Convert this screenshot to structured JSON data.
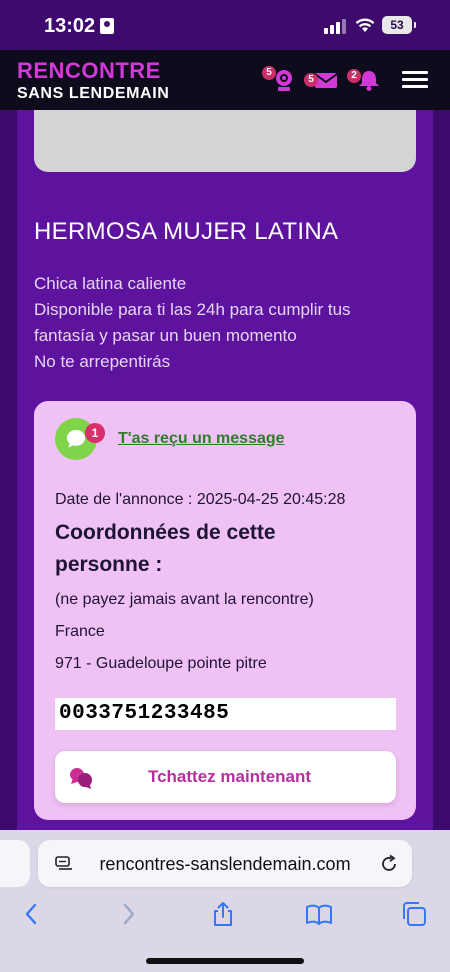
{
  "status_bar": {
    "time": "13:02",
    "battery": "53"
  },
  "header": {
    "logo_line1": "RENCONTRE",
    "logo_line2": "SANS LENDEMAIN",
    "webcam_badge": "5",
    "mail_badge": "5",
    "bell_badge": "2",
    "accent_color": "#d13ad7"
  },
  "ad": {
    "title": "HERMOSA MUJER LATINA",
    "description": [
      "Chica latina caliente",
      "Disponible para ti las 24h para cumplir tus",
      "fantasía y pasar un buen momento",
      "No te arrepentirás"
    ]
  },
  "info_box": {
    "message_badge": "1",
    "message_link": "T'as reçu un message",
    "date_line": "Date de l'annonce : 2025-04-25 20:45:28",
    "coords_heading": "Coordonnées de cette personne :",
    "warning": "(ne payez jamais avant la rencontre)",
    "country": "France",
    "region": "971 - Guadeloupe pointe pitre",
    "phone": "0033751233485",
    "chat_button": "Tchattez maintenant"
  },
  "browser": {
    "url": "rencontres-sanslendemain.com"
  }
}
